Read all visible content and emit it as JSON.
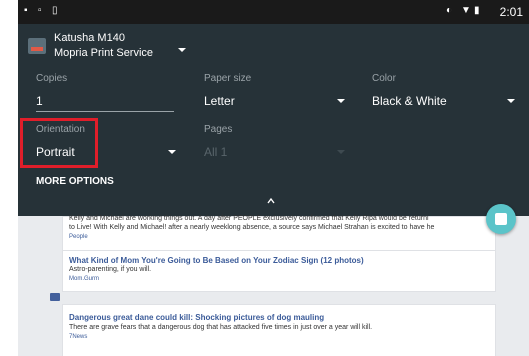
{
  "status_bar": {
    "time": "2:01",
    "icons": [
      "notification-icon",
      "media-icon",
      "screenshot-icon",
      "vibrate-icon",
      "wifi-icon",
      "battery-icon"
    ]
  },
  "printer": {
    "name": "Katusha M140",
    "service": "Mopria Print Service"
  },
  "fields": {
    "copies_label": "Copies",
    "copies_value": "1",
    "paper_size_label": "Paper size",
    "paper_size_value": "Letter",
    "color_label": "Color",
    "color_value": "Black & White",
    "orientation_label": "Orientation",
    "orientation_value": "Portrait",
    "pages_label": "Pages",
    "pages_value": "All 1"
  },
  "more_options_label": "MORE OPTIONS",
  "feed": {
    "story1": {
      "description_line1": "Kelly and Michael are working things out. A day after PEOPLE exclusively confirmed that Kelly Ripa would be returni",
      "description_line2": "to Live! With Kelly and Michael! after a nearly weeklong absence, a source says Michael Strahan is excited to have he",
      "source": "People"
    },
    "story2": {
      "title": "What Kind of Mom You're Going to Be Based on Your Zodiac Sign",
      "photos": "(12 photos)",
      "description": "Astro-parenting, if you will.",
      "source": "Mom.Gurm"
    },
    "story3": {
      "title": "Dangerous great dane could kill: Shocking pictures of dog mauling",
      "description": "There are grave fears that a dangerous dog that has attacked five times in just over a year will kill.",
      "source": "7News"
    }
  },
  "colors": {
    "panel_bg": "#263238",
    "highlight": "#e01e2a",
    "fab": "#5bc4c9"
  }
}
